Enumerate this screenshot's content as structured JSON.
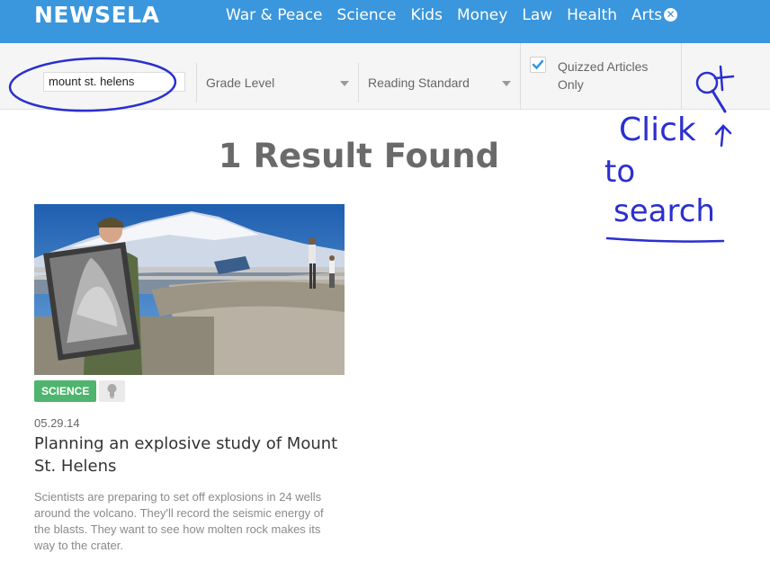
{
  "header": {
    "logo": "NEWSELA",
    "nav": [
      "War & Peace",
      "Science",
      "Kids",
      "Money",
      "Law",
      "Health",
      "Arts"
    ],
    "close_icon": "close-circle-icon"
  },
  "filters": {
    "search_value": "mount st. helens",
    "grade_level": "Grade Level",
    "reading_standard": "Reading Standard",
    "quizzed_label": "Quizzed Articles Only",
    "quizzed_checked": true
  },
  "annotation": {
    "line1": "Click",
    "line2": "to",
    "line3": "search"
  },
  "results": {
    "count_text": "1 Result Found",
    "articles": [
      {
        "tag": "SCIENCE",
        "tag_color": "#4fb46d",
        "date": "05.29.14",
        "headline": "Planning an explosive study of Mount St. Helens",
        "summary": "Scientists are preparing to set off explosions in 24 wells around the volcano. They'll record the seismic energy of the blasts. They want to see how molten rock makes its way to the crater."
      }
    ]
  },
  "colors": {
    "brand": "#3a96dd",
    "annotation_ink": "#2a2fd0"
  }
}
